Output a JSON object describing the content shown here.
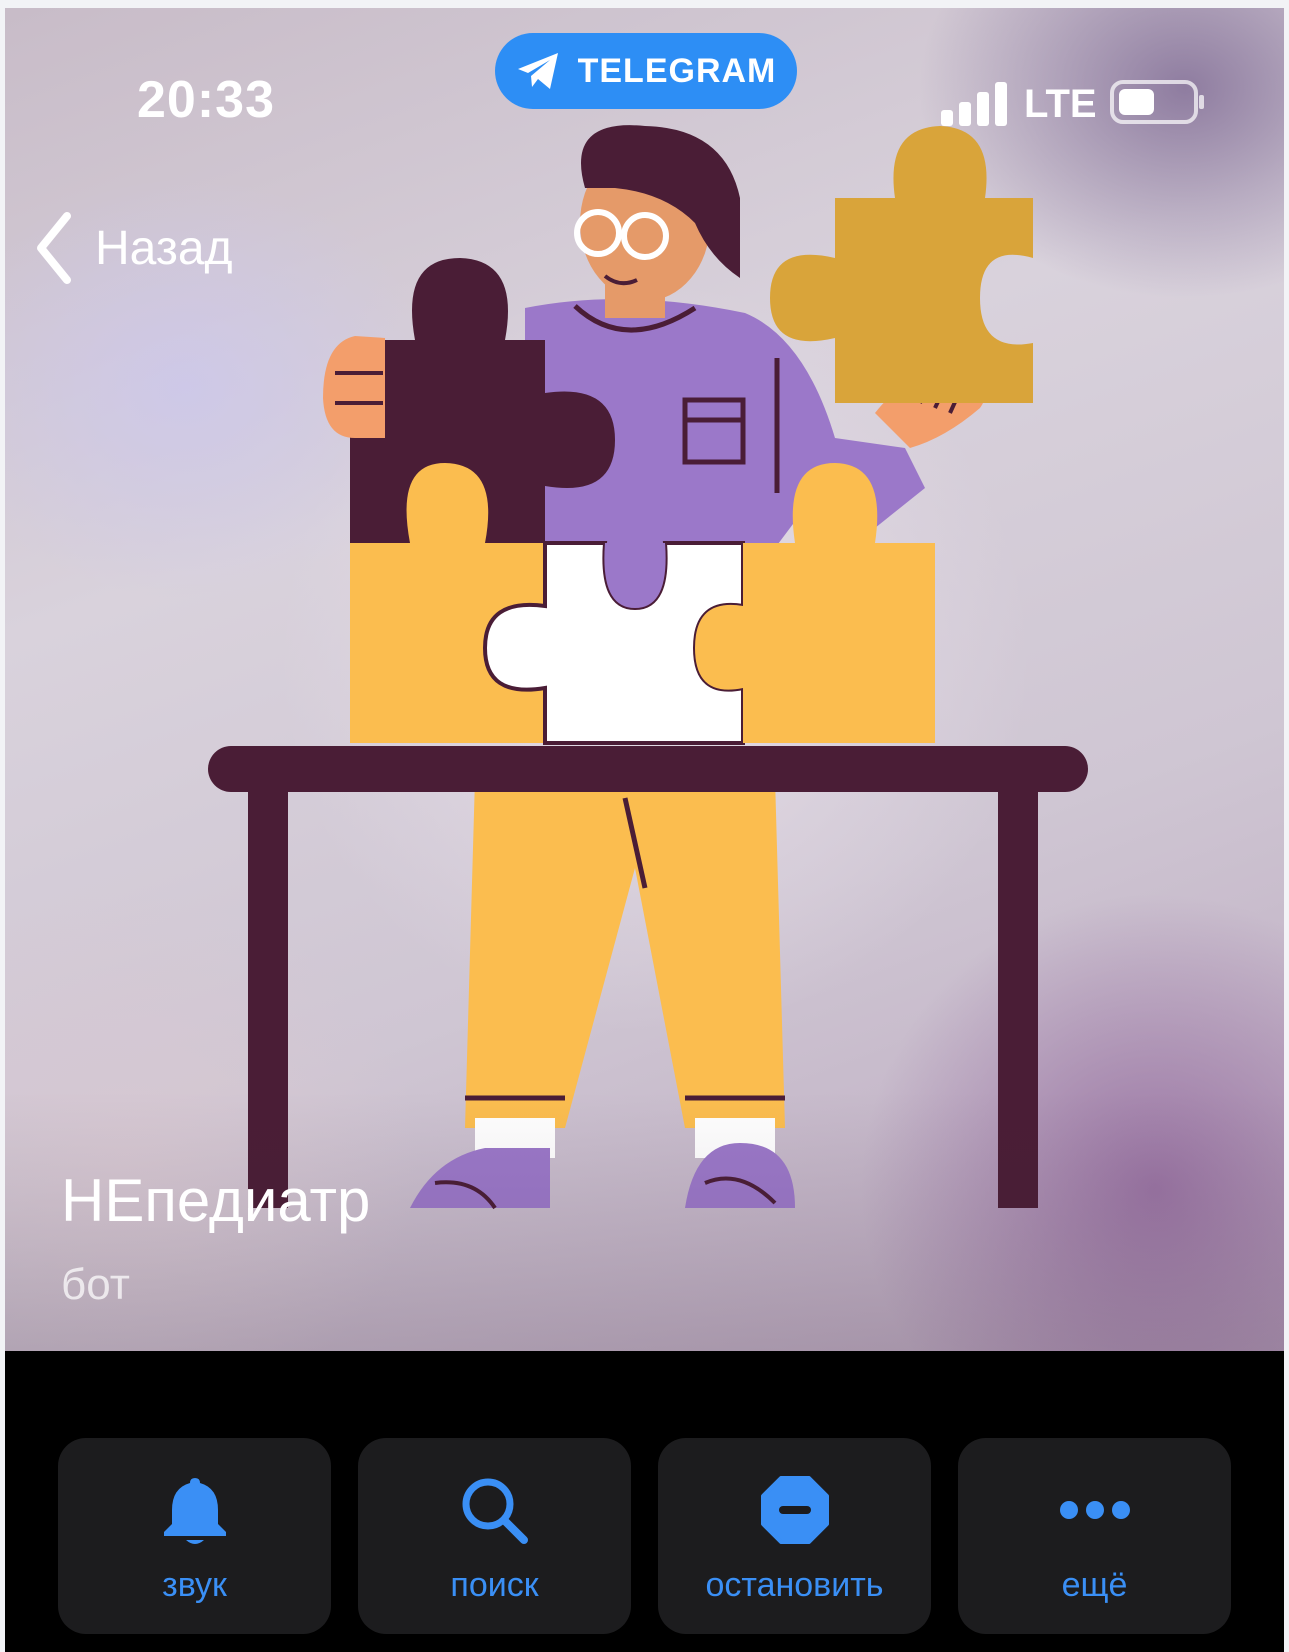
{
  "status_bar": {
    "time": "20:33",
    "app_pill": "TELEGRAM",
    "network": "LTE",
    "signal_level": 1.0,
    "battery_level": 0.5
  },
  "nav": {
    "back_label": "Назад"
  },
  "profile": {
    "name": "НЕпедиатр",
    "subtitle": "бот"
  },
  "actions": [
    {
      "label": "звук",
      "icon": "bell-icon"
    },
    {
      "label": "поиск",
      "icon": "search-icon"
    },
    {
      "label": "остановить",
      "icon": "stop-icon"
    },
    {
      "label": "ещё",
      "icon": "more-icon"
    }
  ],
  "colors": {
    "accent": "#3a8ff5",
    "pill": "#2d8ef5",
    "tile": "#1c1c1e",
    "puzzle_yellow": "#fbbd4f",
    "puzzle_purple": "#9b78c9",
    "puzzle_dark": "#4a1d36"
  }
}
